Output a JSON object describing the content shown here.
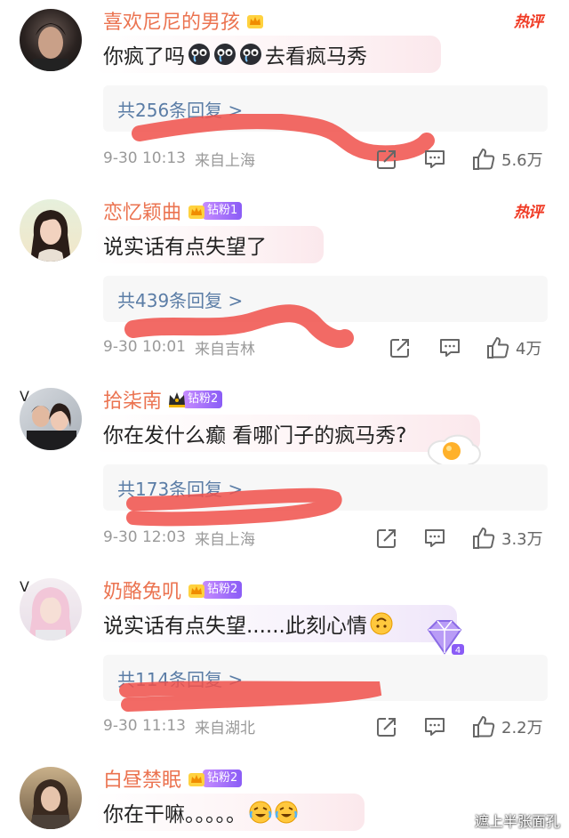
{
  "comments": [
    {
      "name": "喜欢尼尼的男孩",
      "fan_badge": "",
      "verified": false,
      "hot_label": "热评",
      "text": "你疯了吗",
      "text_suffix": "去看疯马秀",
      "replies": "共256条回复 >",
      "time": "9-30 10:13",
      "location": "来自上海",
      "likes": "5.6万"
    },
    {
      "name": "恋忆颖曲",
      "fan_badge": "钻粉1",
      "verified": false,
      "hot_label": "热评",
      "text": "说实话有点失望了",
      "replies": "共439条回复 >",
      "time": "9-30 10:01",
      "location": "来自吉林",
      "likes": "4万"
    },
    {
      "name": "拾柒南",
      "fan_badge": "钻粉2",
      "verified": true,
      "verified_mark": "V",
      "text": "你在发什么癫 看哪门子的疯马秀?",
      "replies": "共173条回复 >",
      "time": "9-30 12:03",
      "location": "来自上海",
      "likes": "3.3万"
    },
    {
      "name": "奶酪兔叽",
      "fan_badge": "钻粉2",
      "verified": true,
      "verified_mark": "V",
      "text": "说实话有点失望......此刻心情",
      "replies": "共114条回复 >",
      "time": "9-30 11:13",
      "location": "来自湖北",
      "likes": "2.2万"
    },
    {
      "name": "白昼禁眠",
      "fan_badge": "钻粉2",
      "verified": false,
      "text": "你在干嘛。。。。。"
    }
  ],
  "watermark": "遮上半张面孔",
  "colors": {
    "username": "#eb7350",
    "reply_link": "#5b7da6",
    "hot": "#f03a24",
    "scribble": "#f0504a",
    "meta": "#9a9a9a"
  }
}
